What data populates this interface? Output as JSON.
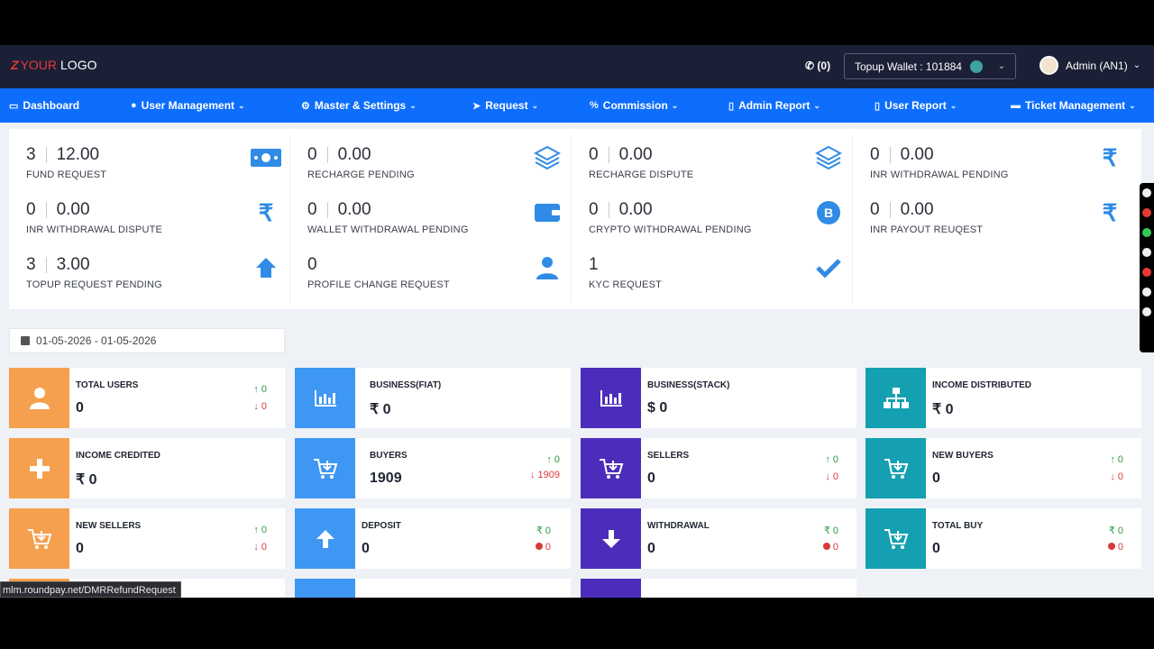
{
  "header": {
    "logo_mark": "Z",
    "logo_your": "YOUR",
    "logo_rest": "LOGO",
    "phone": "(0)",
    "wallet": "Topup Wallet : 101884",
    "admin": "Admin (AN1)"
  },
  "nav": [
    {
      "label": "Dashboard",
      "icon": "monitor-icon"
    },
    {
      "label": "User Management",
      "icon": "user-icon"
    },
    {
      "label": "Master & Settings",
      "icon": "gears-icon"
    },
    {
      "label": "Request",
      "icon": "paper-plane-icon"
    },
    {
      "label": "Commission",
      "icon": "percent-icon"
    },
    {
      "label": "Admin Report",
      "icon": "file-icon"
    },
    {
      "label": "User Report",
      "icon": "file-icon"
    },
    {
      "label": "Ticket Management",
      "icon": "ticket-icon"
    }
  ],
  "stats": [
    {
      "count": "3",
      "amount": "12.00",
      "label": "FUND REQUEST",
      "icon": "money-icon"
    },
    {
      "count": "0",
      "amount": "0.00",
      "label": "RECHARGE PENDING",
      "icon": "layers-icon"
    },
    {
      "count": "0",
      "amount": "0.00",
      "label": "RECHARGE DISPUTE",
      "icon": "layers-icon"
    },
    {
      "count": "0",
      "amount": "0.00",
      "label": "INR WITHDRAWAL PENDING",
      "icon": "rupee-icon"
    },
    {
      "count": "0",
      "amount": "0.00",
      "label": "INR WITHDRAWAL DISPUTE",
      "icon": "rupee-icon"
    },
    {
      "count": "0",
      "amount": "0.00",
      "label": "WALLET WITHDRAWAL PENDING",
      "icon": "wallet-icon"
    },
    {
      "count": "0",
      "amount": "0.00",
      "label": "CRYPTO WITHDRAWAL PENDING",
      "icon": "bitcoin-icon"
    },
    {
      "count": "0",
      "amount": "0.00",
      "label": "INR PAYOUT REUQEST",
      "icon": "rupee-icon"
    },
    {
      "count": "3",
      "amount": "3.00",
      "label": "TOPUP REQUEST PENDING",
      "icon": "arrow-up-icon"
    },
    {
      "count": "0",
      "amount": "",
      "label": "PROFILE CHANGE REQUEST",
      "icon": "user-icon"
    },
    {
      "count": "1",
      "amount": "",
      "label": "KYC REQUEST",
      "icon": "check-icon"
    }
  ],
  "date_range": "01-05-2026 - 01-05-2026",
  "cards": [
    {
      "title": "TOTAL USERS",
      "value": "0",
      "up": "0",
      "down": "0",
      "color": "#f5a04e",
      "icon": "user-icon"
    },
    {
      "title": "BUSINESS(FIAT)",
      "value": "₹ 0",
      "up": "",
      "down": "",
      "color": "#3f97f4",
      "icon": "bar-chart-icon"
    },
    {
      "title": "BUSINESS(STACK)",
      "value": "$ 0",
      "up": "",
      "down": "",
      "color": "#4c2dbb",
      "icon": "bar-chart-icon"
    },
    {
      "title": "INCOME DISTRIBUTED",
      "value": "₹ 0",
      "up": "",
      "down": "",
      "color": "#14a0b0",
      "icon": "sitemap-icon"
    },
    {
      "title": "INCOME CREDITED",
      "value": "₹ 0",
      "up": "",
      "down": "",
      "color": "#f5a04e",
      "icon": "plus-icon"
    },
    {
      "title": "BUYERS",
      "value": "1909",
      "up": "0",
      "down": "1909",
      "color": "#3f97f4",
      "icon": "cart-icon"
    },
    {
      "title": "SELLERS",
      "value": "0",
      "up": "0",
      "down": "0",
      "color": "#4c2dbb",
      "icon": "cart-icon"
    },
    {
      "title": "NEW BUYERS",
      "value": "0",
      "up": "0",
      "down": "0",
      "color": "#14a0b0",
      "icon": "cart-icon"
    },
    {
      "title": "NEW SELLERS",
      "value": "0",
      "up": "0",
      "down": "0",
      "color": "#f5a04e",
      "icon": "cart-icon"
    },
    {
      "title": "DEPOSIT",
      "value": "0",
      "up": "₹ 0",
      "down": "0",
      "color": "#3f97f4",
      "icon": "arrow-up-icon"
    },
    {
      "title": "WITHDRAWAL",
      "value": "0",
      "up": "₹ 0",
      "down": "0",
      "color": "#4c2dbb",
      "icon": "arrow-down-icon"
    },
    {
      "title": "TOTAL BUY",
      "value": "0",
      "up": "₹ 0",
      "down": "0",
      "color": "#14a0b0",
      "icon": "cart-icon"
    }
  ],
  "status_url": "mlm.roundpay.net/DMRRefundRequest"
}
